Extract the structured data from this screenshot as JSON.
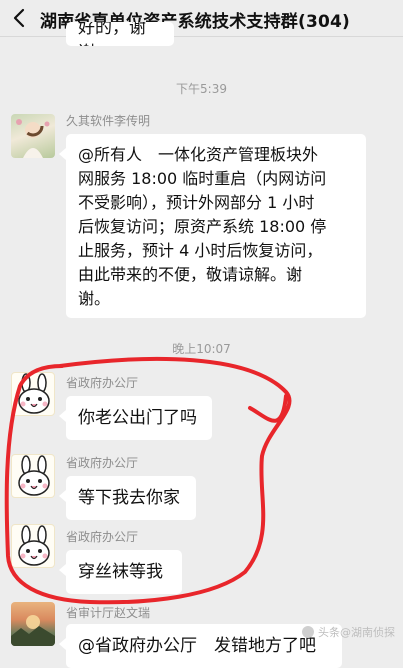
{
  "header": {
    "title": "湖南省直单位资产系统技术支持群(304)"
  },
  "messages": {
    "top_partial_text": "好的，谢谢",
    "time1": "下午5:39",
    "notice_sender": "久其软件李传明",
    "notice_lines": [
      "@所有人　一体化资产管理板块外",
      "网服务 18:00 临时重启（内网访问",
      "不受影响），预计外网部分 1 小时",
      "后恢复访问；原资产系统 18:00 停",
      "止服务，预计 4 小时后恢复访问，",
      "由此带来的不便，敬请谅解。谢",
      "谢。"
    ],
    "time2": "晚上10:07",
    "msg1_sender": "省政府办公厅",
    "msg1_text": "你老公出门了吗",
    "msg2_sender": "省政府办公厅",
    "msg2_text": "等下我去你家",
    "msg3_sender": "省政府办公厅",
    "msg3_text": "穿丝袜等我",
    "msg4_sender": "省审计厅赵文瑞",
    "msg4_text": "@省政府办公厅　发错地方了吧"
  },
  "watermark": "头条@湖南侦探",
  "colors": {
    "background": "#ededed",
    "bubble": "#ffffff",
    "annotation": "#e8262b"
  }
}
